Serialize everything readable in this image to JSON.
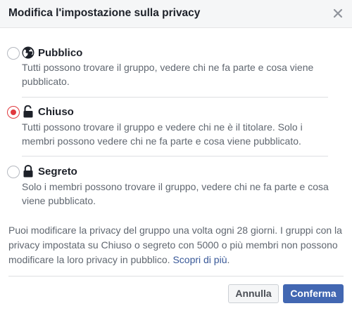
{
  "dialog": {
    "title": "Modifica l'impostazione sulla privacy",
    "close_icon": "close-icon"
  },
  "options": [
    {
      "label": "Pubblico",
      "description": "Tutti possono trovare il gruppo, vedere chi ne fa parte e cosa viene pubblicato.",
      "icon": "globe-icon",
      "selected": false
    },
    {
      "label": "Chiuso",
      "description": "Tutti possono trovare il gruppo e vedere chi ne è il titolare. Solo i membri possono vedere chi ne fa parte e cosa viene pubblicato.",
      "icon": "unlocked-padlock-icon",
      "selected": true
    },
    {
      "label": "Segreto",
      "description": "Solo i membri possono trovare il gruppo, vedere chi ne fa parte e cosa viene pubblicato.",
      "icon": "locked-padlock-icon",
      "selected": false
    }
  ],
  "info": {
    "text": "Puoi modificare la privacy del gruppo una volta ogni 28 giorni. I gruppi con la privacy impostata su Chiuso o segreto con 5000 o più membri non possono modificare la loro privacy in pubblico. ",
    "link": "Scopri di più",
    "trailing": "."
  },
  "buttons": {
    "cancel": "Annulla",
    "confirm": "Conferma"
  },
  "colors": {
    "accent_selected": "#e0393e",
    "primary_button": "#4267b2",
    "link": "#385898"
  }
}
